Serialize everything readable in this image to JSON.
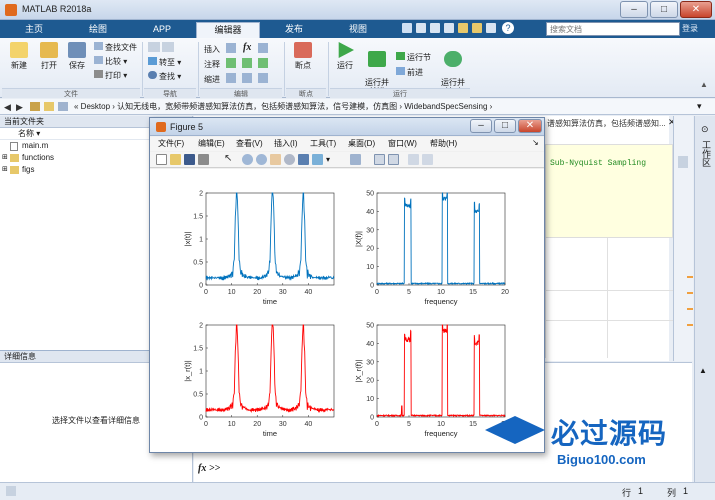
{
  "window": {
    "title": "MATLAB R2018a"
  },
  "tabs": [
    "主页",
    "绘图",
    "APP",
    "编辑器",
    "发布",
    "视图"
  ],
  "active_tab": "编辑器",
  "search": {
    "placeholder": "搜索文档",
    "login": "登录"
  },
  "ribbon": {
    "file": {
      "new": "新建",
      "open": "打开",
      "save": "保存",
      "find_files": "查找文件",
      "compare": "比较",
      "print": "打印",
      "group": "文件"
    },
    "navigate": {
      "goto": "转至",
      "find": "查找",
      "group": "导航"
    },
    "edit": {
      "insert": "插入",
      "comment": "注释",
      "indent": "缩进",
      "fx": "fx",
      "group": "编辑"
    },
    "breakpoints": {
      "label": "断点",
      "group": "断点"
    },
    "run": {
      "run": "运行",
      "run_advance": "运行并\n前进",
      "run_section": "运行节",
      "advance": "前进",
      "run_time": "运行并\n计时",
      "group": "运行"
    }
  },
  "address": {
    "path": "« Desktop › 认知无线电，宽频带频谱感知算法仿真，包括频谱感知算法，信号建模，仿真图 › WidebandSpecSensing ›",
    "overflow": "谱感知算法仿真，包括频谱感知..."
  },
  "current_folder": {
    "title": "当前文件夹",
    "col_name": "名称 ▾",
    "items": [
      {
        "name": "main.m",
        "kind": "file"
      },
      {
        "name": "functions",
        "kind": "folder"
      },
      {
        "name": "figs",
        "kind": "folder"
      }
    ]
  },
  "details": {
    "title": "详细信息",
    "hint": "选择文件以查看详细信息"
  },
  "editor": {
    "code": "Sub-Nyquist Sampling"
  },
  "command_window": {
    "prompt": "fx >>"
  },
  "workspace_tab": "工作区",
  "status": {
    "row_label": "行",
    "row": "1",
    "col_label": "列",
    "col": "1"
  },
  "figure": {
    "title": "Figure 5",
    "menus": [
      "文件(F)",
      "编辑(E)",
      "查看(V)",
      "插入(I)",
      "工具(T)",
      "桌面(D)",
      "窗口(W)",
      "帮助(H)"
    ],
    "colors": {
      "blue": "#0072bd",
      "red": "#ff0000"
    }
  },
  "chart_data": [
    {
      "type": "line",
      "color": "#0072bd",
      "xlabel": "time",
      "ylabel": "|x(t)|",
      "xlim": [
        0,
        50
      ],
      "ylim": [
        0,
        2
      ],
      "xticks": [
        0,
        10,
        20,
        30,
        40
      ],
      "yticks": [
        0,
        0.5,
        1,
        1.5,
        2
      ],
      "peaks": [
        {
          "x": 12,
          "y": 1.85
        },
        {
          "x": 26,
          "y": 1.95
        },
        {
          "x": 38,
          "y": 1.75
        }
      ]
    },
    {
      "type": "line",
      "color": "#0072bd",
      "xlabel": "frequency",
      "ylabel": "|X(f)|",
      "xlim": [
        0,
        20
      ],
      "ylim": [
        0,
        50
      ],
      "xticks": [
        0,
        5,
        10,
        15,
        20
      ],
      "yticks": [
        0,
        10,
        20,
        30,
        40,
        50
      ],
      "bands": [
        {
          "from": 4.3,
          "to": 5.3,
          "level": 43
        },
        {
          "from": 10.2,
          "to": 11.0,
          "level": 47
        },
        {
          "from": 15.2,
          "to": 16.0,
          "level": 40
        }
      ]
    },
    {
      "type": "line",
      "color": "#ff0000",
      "xlabel": "time",
      "ylabel": "|x_r(t)|",
      "xlim": [
        0,
        50
      ],
      "ylim": [
        0,
        2
      ],
      "xticks": [
        0,
        10,
        20,
        30,
        40
      ],
      "yticks": [
        0,
        0.5,
        1,
        1.5,
        2
      ],
      "peaks": [
        {
          "x": 12,
          "y": 1.8
        },
        {
          "x": 26,
          "y": 1.95
        },
        {
          "x": 38,
          "y": 1.75
        }
      ]
    },
    {
      "type": "line",
      "color": "#ff0000",
      "xlabel": "frequency",
      "ylabel": "|X_r(f)|",
      "xlim": [
        0,
        20
      ],
      "ylim": [
        0,
        50
      ],
      "xticks": [
        0,
        5,
        10,
        15,
        20
      ],
      "yticks": [
        0,
        10,
        20,
        30,
        40,
        50
      ],
      "bands": [
        {
          "from": 4.3,
          "to": 5.3,
          "level": 42
        },
        {
          "from": 10.2,
          "to": 11.0,
          "level": 47
        },
        {
          "from": 15.2,
          "to": 16.0,
          "level": 40
        }
      ]
    }
  ],
  "watermark": {
    "cn": "必过源码",
    "url": "Biguo100.com"
  }
}
